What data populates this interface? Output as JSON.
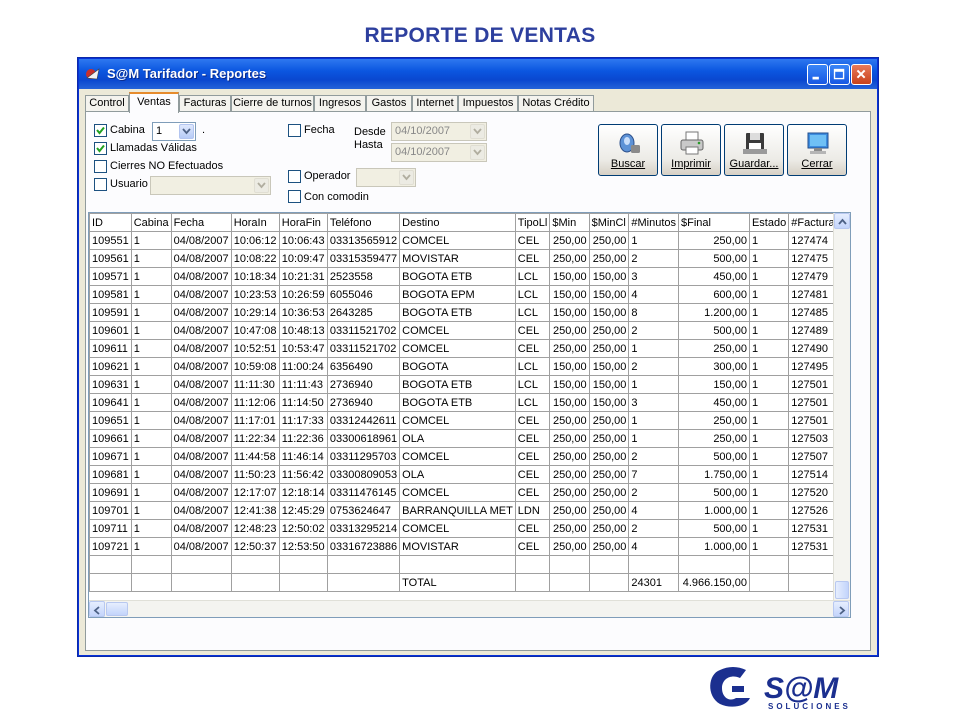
{
  "slide": {
    "title": "REPORTE DE VENTAS"
  },
  "window": {
    "title": "S@M Tarifador - Reportes"
  },
  "tabs": [
    "Control",
    "Ventas",
    "Facturas",
    "Cierre de turnos",
    "Ingresos",
    "Gastos",
    "Internet",
    "Impuestos",
    "Notas Crédito"
  ],
  "active_tab": "Ventas",
  "filters": {
    "cabina_label": "Cabina",
    "cabina_value": "1",
    "cabina_dot": ".",
    "llamadas_validas_label": "Llamadas Válidas",
    "cierres_label": "Cierres NO Efectuados",
    "usuario_label": "Usuario",
    "usuario_value": "",
    "fecha_label": "Fecha",
    "desde_label": "Desde",
    "hasta_label": "Hasta",
    "desde_value": "04/10/2007",
    "hasta_value": "04/10/2007",
    "operador_label": "Operador",
    "operador_value": "",
    "comodin_label": "Con comodin",
    "checked": {
      "cabina": true,
      "llamadas_validas": true,
      "cierres": false,
      "usuario": false,
      "fecha": false,
      "operador": false,
      "comodin": false
    }
  },
  "buttons": {
    "buscar": "Buscar",
    "imprimir": "Imprimir",
    "guardar": "Guardar...",
    "cerrar": "Cerrar"
  },
  "table": {
    "columns": [
      "ID",
      "Cabina",
      "Fecha",
      "HoraIn",
      "HoraFin",
      "Teléfono",
      "Destino",
      "TipoLl",
      "$Min",
      "$MinCl",
      "#Minutos",
      "$Final",
      "Estado",
      "#Factura",
      "$"
    ],
    "rows": [
      [
        "109551",
        "1",
        "04/08/2007",
        "10:06:12",
        "10:06:43",
        "03313565912",
        "COMCEL",
        "CEL",
        "250,00",
        "250,00",
        "1",
        "250,00",
        "1",
        "127474"
      ],
      [
        "109561",
        "1",
        "04/08/2007",
        "10:08:22",
        "10:09:47",
        "03315359477",
        "MOVISTAR",
        "CEL",
        "250,00",
        "250,00",
        "2",
        "500,00",
        "1",
        "127475"
      ],
      [
        "109571",
        "1",
        "04/08/2007",
        "10:18:34",
        "10:21:31",
        "2523558",
        "BOGOTA ETB",
        "LCL",
        "150,00",
        "150,00",
        "3",
        "450,00",
        "1",
        "127479"
      ],
      [
        "109581",
        "1",
        "04/08/2007",
        "10:23:53",
        "10:26:59",
        "6055046",
        "BOGOTA EPM",
        "LCL",
        "150,00",
        "150,00",
        "4",
        "600,00",
        "1",
        "127481"
      ],
      [
        "109591",
        "1",
        "04/08/2007",
        "10:29:14",
        "10:36:53",
        "2643285",
        "BOGOTA ETB",
        "LCL",
        "150,00",
        "150,00",
        "8",
        "1.200,00",
        "1",
        "127485"
      ],
      [
        "109601",
        "1",
        "04/08/2007",
        "10:47:08",
        "10:48:13",
        "03311521702",
        "COMCEL",
        "CEL",
        "250,00",
        "250,00",
        "2",
        "500,00",
        "1",
        "127489"
      ],
      [
        "109611",
        "1",
        "04/08/2007",
        "10:52:51",
        "10:53:47",
        "03311521702",
        "COMCEL",
        "CEL",
        "250,00",
        "250,00",
        "1",
        "250,00",
        "1",
        "127490"
      ],
      [
        "109621",
        "1",
        "04/08/2007",
        "10:59:08",
        "11:00:24",
        "6356490",
        "BOGOTA",
        "LCL",
        "150,00",
        "150,00",
        "2",
        "300,00",
        "1",
        "127495"
      ],
      [
        "109631",
        "1",
        "04/08/2007",
        "11:11:30",
        "11:11:43",
        "2736940",
        "BOGOTA ETB",
        "LCL",
        "150,00",
        "150,00",
        "1",
        "150,00",
        "1",
        "127501"
      ],
      [
        "109641",
        "1",
        "04/08/2007",
        "11:12:06",
        "11:14:50",
        "2736940",
        "BOGOTA ETB",
        "LCL",
        "150,00",
        "150,00",
        "3",
        "450,00",
        "1",
        "127501"
      ],
      [
        "109651",
        "1",
        "04/08/2007",
        "11:17:01",
        "11:17:33",
        "03312442611",
        "COMCEL",
        "CEL",
        "250,00",
        "250,00",
        "1",
        "250,00",
        "1",
        "127501"
      ],
      [
        "109661",
        "1",
        "04/08/2007",
        "11:22:34",
        "11:22:36",
        "03300618961",
        "OLA",
        "CEL",
        "250,00",
        "250,00",
        "1",
        "250,00",
        "1",
        "127503"
      ],
      [
        "109671",
        "1",
        "04/08/2007",
        "11:44:58",
        "11:46:14",
        "03311295703",
        "COMCEL",
        "CEL",
        "250,00",
        "250,00",
        "2",
        "500,00",
        "1",
        "127507"
      ],
      [
        "109681",
        "1",
        "04/08/2007",
        "11:50:23",
        "11:56:42",
        "03300809053",
        "OLA",
        "CEL",
        "250,00",
        "250,00",
        "7",
        "1.750,00",
        "1",
        "127514"
      ],
      [
        "109691",
        "1",
        "04/08/2007",
        "12:17:07",
        "12:18:14",
        "03311476145",
        "COMCEL",
        "CEL",
        "250,00",
        "250,00",
        "2",
        "500,00",
        "1",
        "127520"
      ],
      [
        "109701",
        "1",
        "04/08/2007",
        "12:41:38",
        "12:45:29",
        "0753624647",
        "BARRANQUILLA MET",
        "LDN",
        "250,00",
        "250,00",
        "4",
        "1.000,00",
        "1",
        "127526"
      ],
      [
        "109711",
        "1",
        "04/08/2007",
        "12:48:23",
        "12:50:02",
        "03313295214",
        "COMCEL",
        "CEL",
        "250,00",
        "250,00",
        "2",
        "500,00",
        "1",
        "127531"
      ],
      [
        "109721",
        "1",
        "04/08/2007",
        "12:50:37",
        "12:53:50",
        "03316723886",
        "MOVISTAR",
        "CEL",
        "250,00",
        "250,00",
        "4",
        "1.000,00",
        "1",
        "127531"
      ]
    ],
    "total_label": "TOTAL",
    "total_minutos": "24301",
    "total_final": "4.966.150,00"
  },
  "logo": {
    "text": "S@M",
    "sub": "SOLUCIONES",
    "color": "#1b2f8f"
  }
}
